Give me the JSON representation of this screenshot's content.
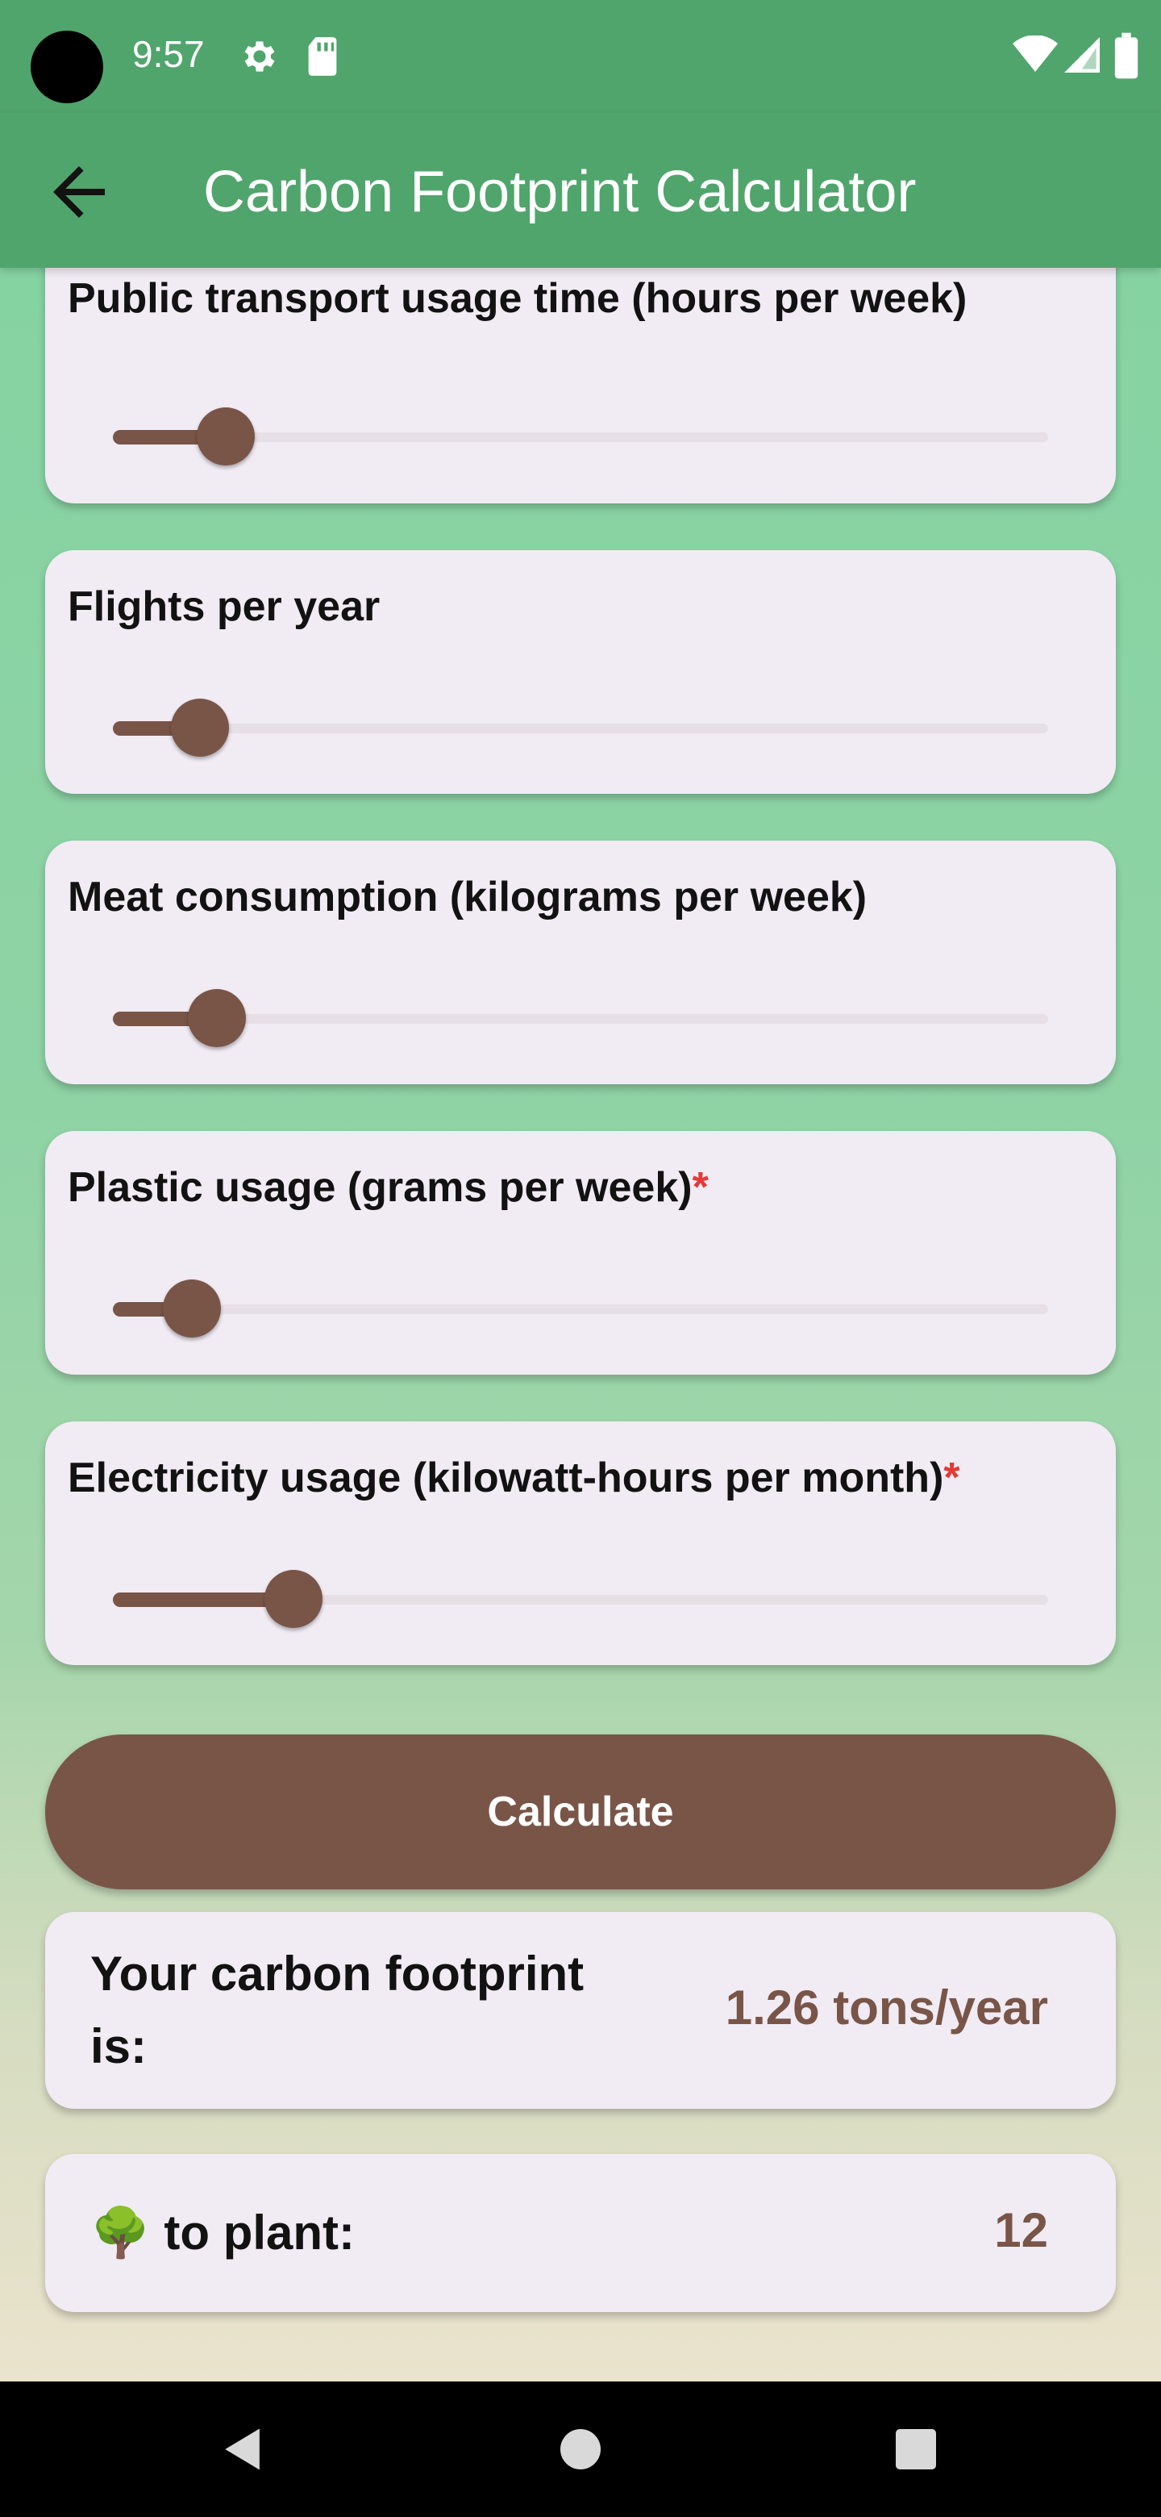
{
  "status_bar": {
    "time": "9:57"
  },
  "app_bar": {
    "title": "Carbon Footprint Calculator"
  },
  "sliders": [
    {
      "label": "Public transport usage time (hours per week)",
      "required": "",
      "value_fraction": 0.08
    },
    {
      "label": "Flights per year",
      "required": "",
      "value_fraction": 0.05
    },
    {
      "label": "Meat consumption (kilograms per week)",
      "required": "",
      "value_fraction": 0.07
    },
    {
      "label": "Plastic usage (grams per week)",
      "required": "*",
      "value_fraction": 0.04
    },
    {
      "label": "Electricity usage (kilowatt-hours per month)",
      "required": "*",
      "value_fraction": 0.16
    }
  ],
  "calculate_label": "Calculate",
  "result": {
    "label": "Your carbon footprint is:",
    "value": "1.26 tons/year"
  },
  "trees": {
    "emoji": "🌳",
    "label": "to plant:",
    "value": "12"
  },
  "colors": {
    "primary": "#50a56c",
    "accent": "#795548",
    "card": "#f1ebf4",
    "required": "#e53935"
  }
}
